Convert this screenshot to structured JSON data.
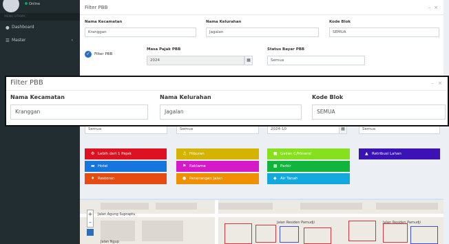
{
  "sidebar": {
    "status": "Online",
    "menu_header": "MENU UTAMA",
    "items": [
      {
        "label": "Dashboard",
        "icon": "dashboard-icon"
      },
      {
        "label": "Master",
        "icon": "list-icon"
      }
    ]
  },
  "panel": {
    "title": "Filter PBB",
    "fields": {
      "kecamatan": {
        "label": "Nama Kecamatan",
        "value": "Kranggan"
      },
      "kelurahan": {
        "label": "Nama Kelurahan",
        "value": "Jagalan"
      },
      "kode_blok": {
        "label": "Kode Blok",
        "value": "SEMUA"
      },
      "masa_pajak": {
        "label": "Masa Pajak PBB",
        "value": "2024"
      },
      "status_bayar": {
        "label": "Status Bayar PBB",
        "value": "Semua"
      }
    },
    "checkbox_label": "Filter PBB",
    "filter_row": [
      "Semua",
      "Semua",
      "2024-10",
      "Semua"
    ]
  },
  "buttons": [
    {
      "label": "Lebih dari 1 Pajak",
      "color": "#dd1122",
      "icon": "gear-icon"
    },
    {
      "label": "Hiburan",
      "color": "#d4b400",
      "icon": "music-icon"
    },
    {
      "label": "Galian C/Mineral",
      "color": "#86e01e",
      "icon": "truck-icon"
    },
    {
      "label": "Retribusi Lahan",
      "color": "#3a12b5",
      "icon": "bell-icon"
    },
    {
      "label": "Hotel",
      "color": "#1676dd",
      "icon": "bed-icon"
    },
    {
      "label": "Reklame",
      "color": "#d41bc7",
      "icon": "flag-icon"
    },
    {
      "label": "Parkir",
      "color": "#12b53c",
      "icon": "car-icon"
    },
    {
      "label": "Restoran",
      "color": "#e64b12",
      "icon": "food-icon"
    },
    {
      "label": "Penerangan Jalan",
      "color": "#f08f00",
      "icon": "bulb-icon"
    },
    {
      "label": "Air Tanah",
      "color": "#14a9de",
      "icon": "drop-icon"
    }
  ],
  "map": {
    "labels": [
      "Jalan Agung Supraptu",
      "Jalan Residen Pamudji",
      "Jalan Residen Pamudji",
      "Jalan Ngup"
    ]
  },
  "overlay": {
    "title": "Filter PBB",
    "fields": [
      {
        "label": "Nama Kecamatan",
        "value": "Kranggan"
      },
      {
        "label": "Nama Kelurahan",
        "value": "Jagalan"
      },
      {
        "label": "Kode Blok",
        "value": "SEMUA"
      }
    ]
  }
}
